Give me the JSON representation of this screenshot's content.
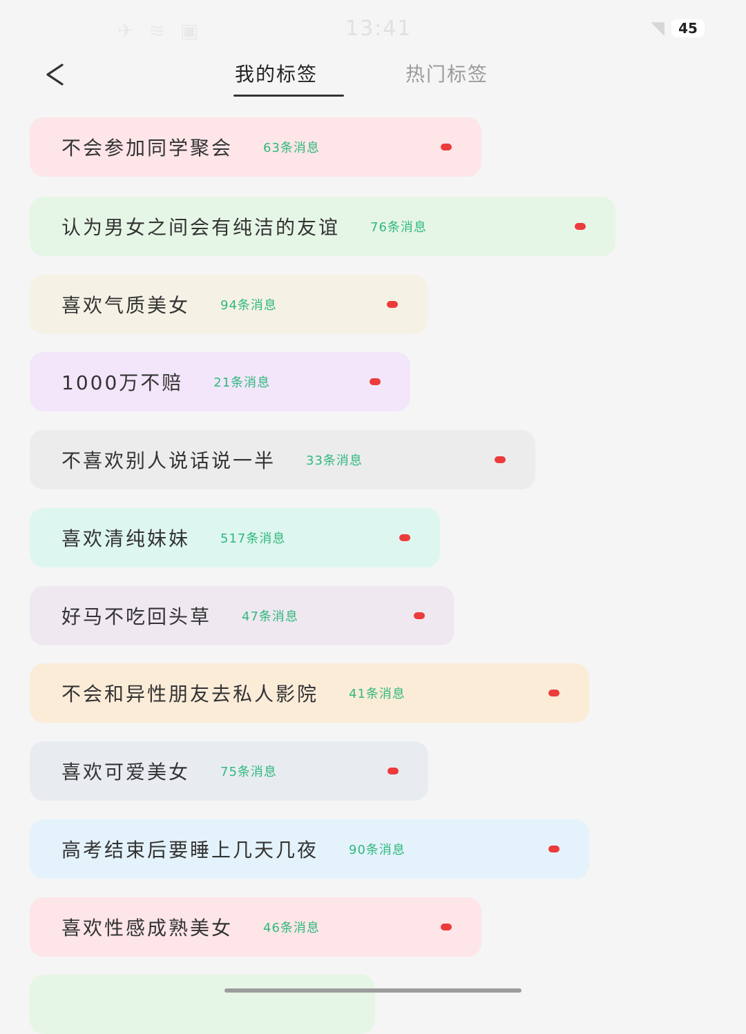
{
  "status": {
    "time": "13:41",
    "battery": "45"
  },
  "header": {
    "back_label": "<",
    "tabs": [
      {
        "label": "我的标签",
        "active": true
      },
      {
        "label": "热门标签",
        "active": false
      }
    ]
  },
  "tags": [
    {
      "name": "不会参加同学聚会",
      "count": "63条消息",
      "color": "#fde5e8"
    },
    {
      "name": "认为男女之间会有纯洁的友谊",
      "count": "76条消息",
      "color": "#e6f6e6"
    },
    {
      "name": "喜欢气质美女",
      "count": "94条消息",
      "color": "#f5f2e5"
    },
    {
      "name": "1000万不赔",
      "count": "21条消息",
      "color": "#f3e6fb"
    },
    {
      "name": "不喜欢别人说话说一半",
      "count": "33条消息",
      "color": "#ececec"
    },
    {
      "name": "喜欢清纯妹妹",
      "count": "517条消息",
      "color": "#def6f0"
    },
    {
      "name": "好马不吃回头草",
      "count": "47条消息",
      "color": "#efe8f1"
    },
    {
      "name": "不会和异性朋友去私人影院",
      "count": "41条消息",
      "color": "#fbecd8"
    },
    {
      "name": "喜欢可爱美女",
      "count": "75条消息",
      "color": "#e8ecf1"
    },
    {
      "name": "高考结束后要睡上几天几夜",
      "count": "90条消息",
      "color": "#e4f2fb"
    },
    {
      "name": "喜欢性感成熟美女",
      "count": "46条消息",
      "color": "#fde5e8"
    },
    {
      "name": "",
      "count": "",
      "color": "#e6f6e6"
    }
  ],
  "colors": {
    "count_text": "#2fb87d",
    "dot": "#ec3b3b",
    "active_tab": "#222222",
    "inactive_tab": "#9a9a9a"
  }
}
